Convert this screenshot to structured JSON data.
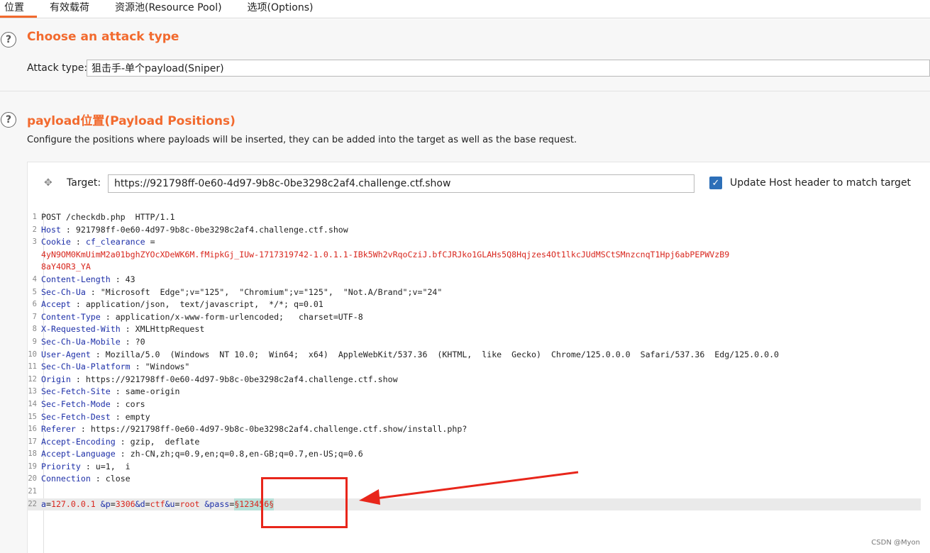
{
  "tabs": [
    {
      "label": "位置",
      "active": true
    },
    {
      "label": "有效载荷",
      "active": false
    },
    {
      "label": "资源池(Resource Pool)",
      "active": false
    },
    {
      "label": "选项(Options)",
      "active": false
    }
  ],
  "attack_section": {
    "title": "Choose an attack type",
    "attack_type_label": "Attack type:",
    "attack_type_value": "狙击手-单个payload(Sniper)"
  },
  "positions_section": {
    "title": "payload位置(Payload Positions)",
    "description": "Configure the positions where payloads will be inserted, they can be added into the target as well as the base request.",
    "target_label": "Target:",
    "target_value": "https://921798ff-0e60-4d97-9b8c-0be3298c2af4.challenge.ctf.show",
    "update_host_label": "Update Host header to match target",
    "update_host_checked": true
  },
  "request": {
    "line1": "POST /checkdb.php  HTTP/1.1",
    "headers": [
      {
        "n": "2",
        "k": "Host",
        "v": " : 921798ff-0e60-4d97-9b8c-0be3298c2af4.challenge.ctf.show"
      },
      {
        "n": "4",
        "k": "Content-Length",
        "v": " : 43"
      },
      {
        "n": "5",
        "k": "Sec-Ch-Ua",
        "v": " : \"Microsoft  Edge\";v=\"125\",  \"Chromium\";v=\"125\",  \"Not.A/Brand\";v=\"24\""
      },
      {
        "n": "6",
        "k": "Accept",
        "v": " : application/json,  text/javascript,  */*; q=0.01"
      },
      {
        "n": "7",
        "k": "Content-Type",
        "v": " : application/x-www-form-urlencoded;   charset=UTF-8"
      },
      {
        "n": "8",
        "k": "X-Requested-With",
        "v": " : XMLHttpRequest"
      },
      {
        "n": "9",
        "k": "Sec-Ch-Ua-Mobile",
        "v": " : ?0"
      },
      {
        "n": "10",
        "k": "User-Agent",
        "v": " : Mozilla/5.0  (Windows  NT 10.0;  Win64;  x64)  AppleWebKit/537.36  (KHTML,  like  Gecko)  Chrome/125.0.0.0  Safari/537.36  Edg/125.0.0.0"
      },
      {
        "n": "11",
        "k": "Sec-Ch-Ua-Platform",
        "v": " : \"Windows\""
      },
      {
        "n": "12",
        "k": "Origin",
        "v": " : https://921798ff-0e60-4d97-9b8c-0be3298c2af4.challenge.ctf.show"
      },
      {
        "n": "13",
        "k": "Sec-Fetch-Site",
        "v": " : same-origin"
      },
      {
        "n": "14",
        "k": "Sec-Fetch-Mode",
        "v": " : cors"
      },
      {
        "n": "15",
        "k": "Sec-Fetch-Dest",
        "v": " : empty"
      },
      {
        "n": "16",
        "k": "Referer",
        "v": " : https://921798ff-0e60-4d97-9b8c-0be3298c2af4.challenge.ctf.show/install.php?"
      },
      {
        "n": "17",
        "k": "Accept-Encoding",
        "v": " : gzip,  deflate"
      },
      {
        "n": "18",
        "k": "Accept-Language",
        "v": " : zh-CN,zh;q=0.9,en;q=0.8,en-GB;q=0.7,en-US;q=0.6"
      },
      {
        "n": "19",
        "k": "Priority",
        "v": " : u=1,  i"
      },
      {
        "n": "20",
        "k": "Connection",
        "v": " : close"
      }
    ],
    "cookie_key": "Cookie",
    "cookie_sep": " : ",
    "cookie_name": "cf_clearance",
    "cookie_eq": " =",
    "cookie_val1": "4yN9OM0KmUimM2a01bghZYOcXDeWK6M.fMipkGj_IUw-1717319742-1.0.1.1-IBk5Wh2vRqoCziJ.bfCJRJko1GLAHs5Q8Hqjzes4Ot1lkcJUdMSCtSMnzcnqT1Hpj6abPEPWVzB9",
    "cookie_val2": "8aY4OR3_YA",
    "body": {
      "a_key": "a",
      "a_val": "127.0.0.1",
      "p_key": "&p",
      "p_val": "3306",
      "d_key": "&d",
      "d_val": "ctf",
      "u_key": "&u",
      "u_val": "root",
      "pass_key": "&pass",
      "payload": "§123456§"
    }
  },
  "watermark": "CSDN @Myon⁠",
  "colors": {
    "accent": "#f26a2e",
    "annotation": "#e8261b",
    "header_key": "#1d2fa8",
    "value_red": "#d8261d"
  }
}
